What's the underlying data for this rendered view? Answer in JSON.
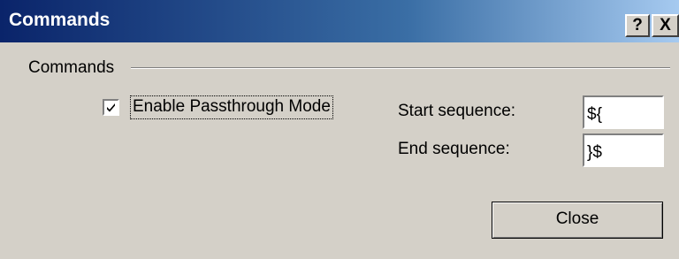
{
  "window": {
    "title": "Commands",
    "help_button": "?",
    "close_button": "X"
  },
  "group": {
    "label": "Commands"
  },
  "passthrough": {
    "label": "Enable Passthrough Mode",
    "checked": true
  },
  "start_sequence": {
    "label": "Start sequence:",
    "value": "${"
  },
  "end_sequence": {
    "label": "End sequence:",
    "value": "}$"
  },
  "buttons": {
    "close_label": "Close"
  },
  "colors": {
    "titlebar_start": "#0a246a",
    "titlebar_end": "#a6caf0",
    "face": "#d4d0c8"
  }
}
